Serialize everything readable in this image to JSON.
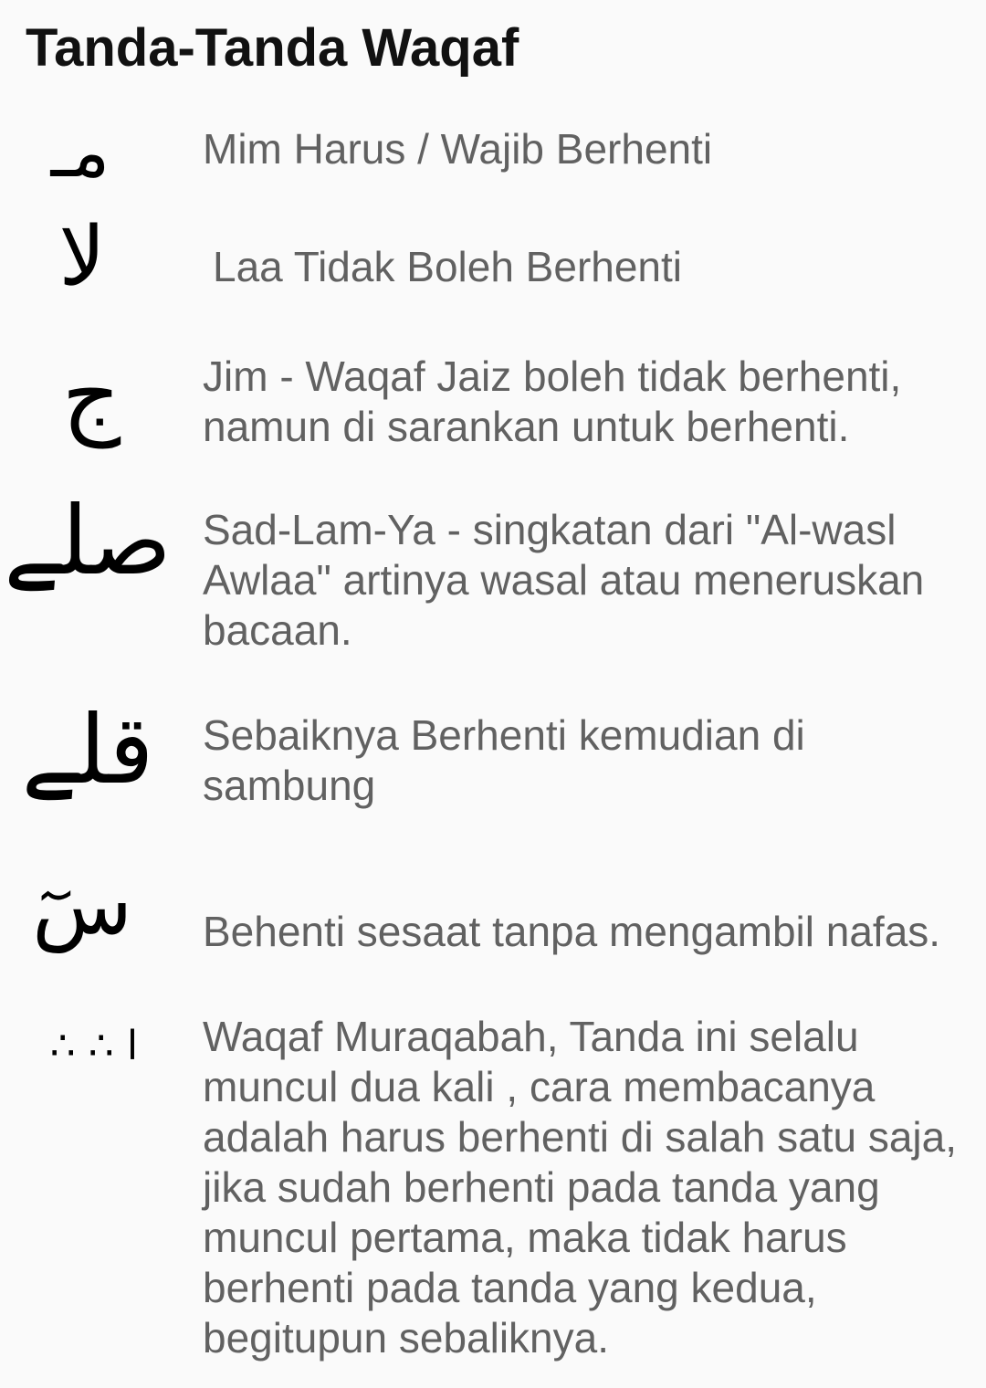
{
  "page": {
    "title": "Tanda-Tanda Waqaf"
  },
  "signs": [
    {
      "icon": "mim-waqaf-icon",
      "glyph": "مـ",
      "description": "Mim Harus / Wajib Berhenti"
    },
    {
      "icon": "laa-waqaf-icon",
      "glyph": "لا",
      "description": "Laa Tidak Boleh Berhenti"
    },
    {
      "icon": "jim-waqaf-icon",
      "glyph": "ج",
      "description": "Jim - Waqaf Jaiz boleh tidak berhenti, namun di sarankan untuk berhenti."
    },
    {
      "icon": "sad-lam-ya-waqaf-icon",
      "glyph": "صلے",
      "description": "Sad-Lam-Ya - singkatan dari \"Al-wasl Awlaa\" artinya wasal atau meneruskan bacaan."
    },
    {
      "icon": "qaf-lam-ya-waqaf-icon",
      "glyph": "قلے",
      "description": "Sebaiknya Berhenti kemudian di sambung"
    },
    {
      "icon": "sin-saktah-icon",
      "glyph": "سٓ",
      "description": "Behenti sesaat tanpa mengambil nafas."
    },
    {
      "icon": "muraqabah-dots-icon",
      "glyph": "ا ∴ ∴",
      "description": "Waqaf Muraqabah, Tanda ini selalu muncul dua kali , cara membacanya adalah harus berhenti di salah satu saja, jika sudah berhenti pada tanda yang muncul pertama, maka tidak harus berhenti pada tanda yang kedua, begitupun sebaliknya."
    }
  ]
}
